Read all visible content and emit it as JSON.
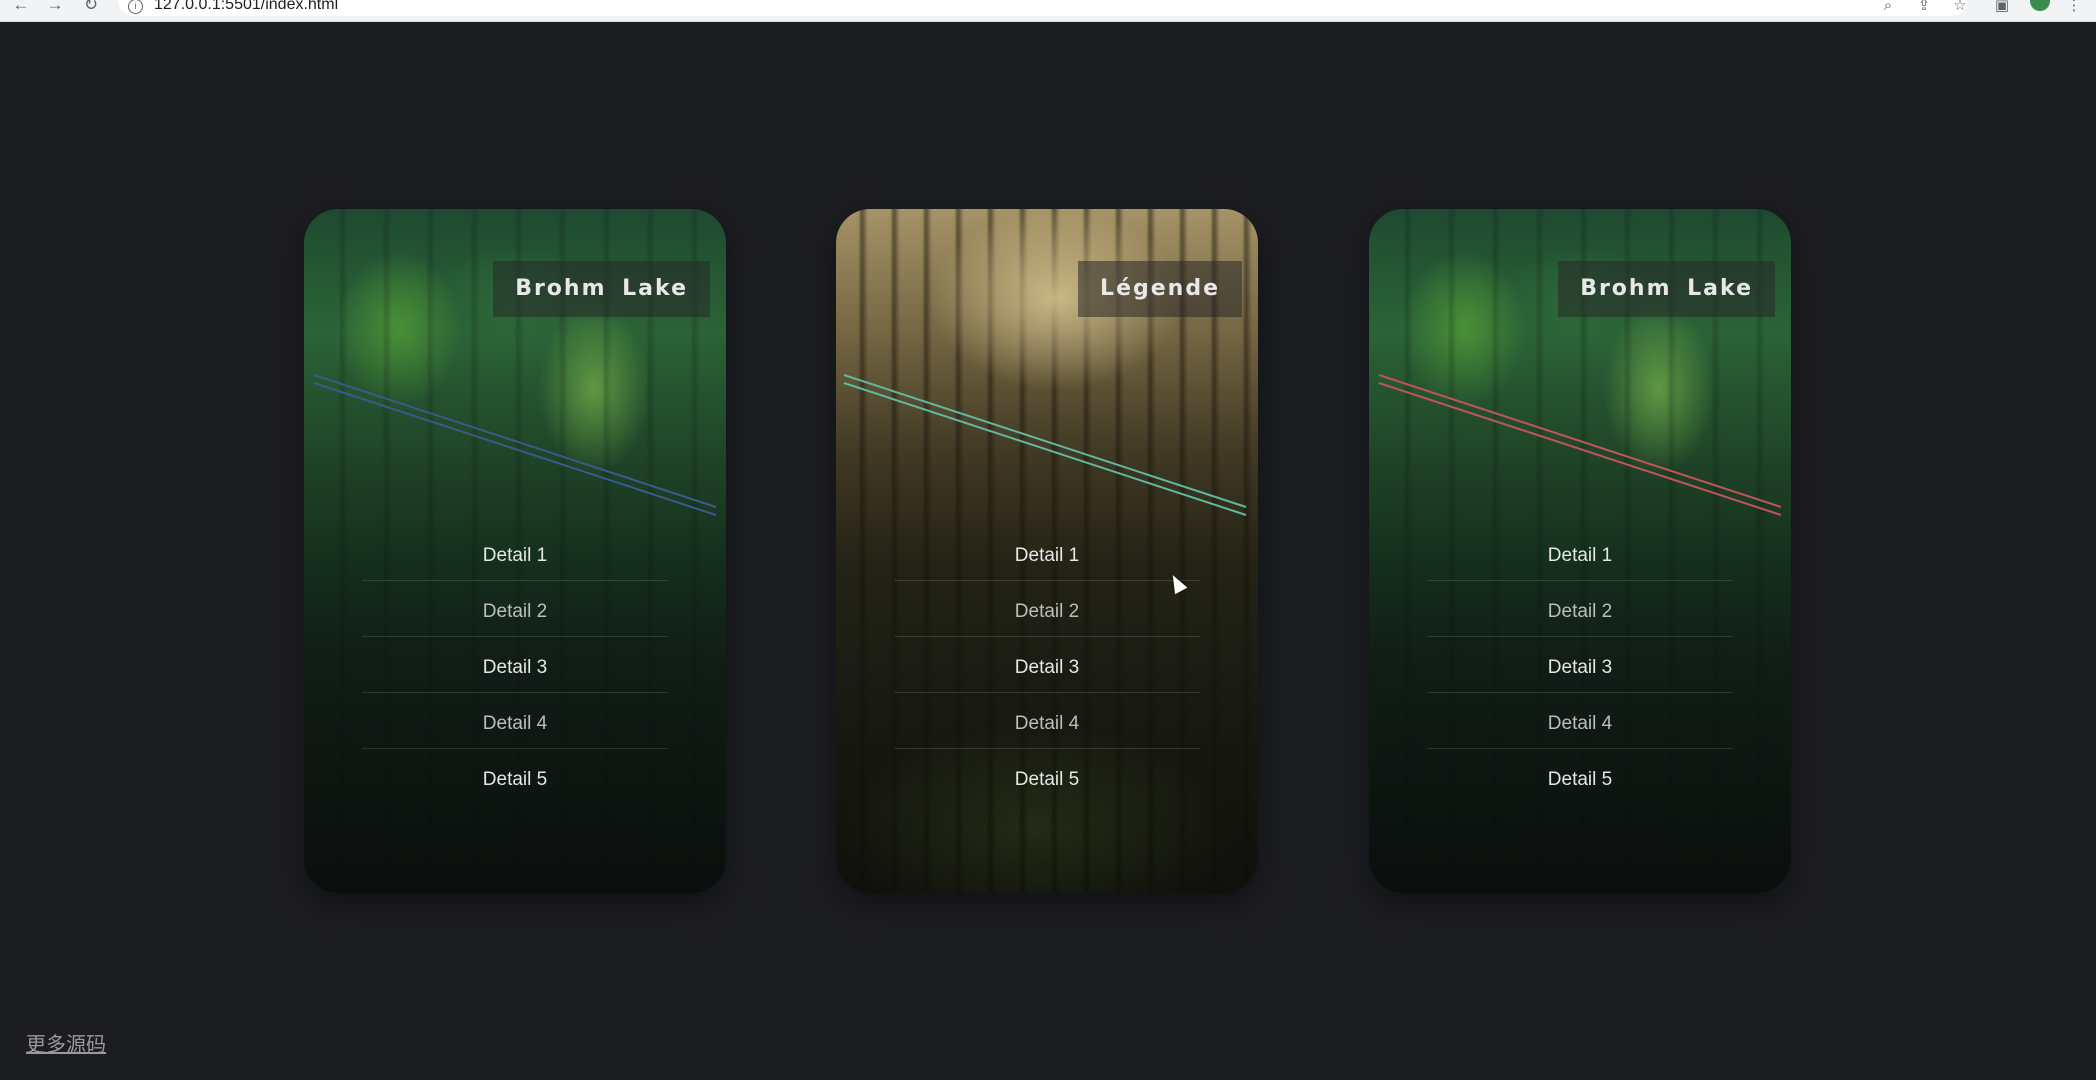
{
  "browser": {
    "url": "127.0.0.1:5501/index.html",
    "icons": [
      "back-icon",
      "forward-icon",
      "reload-icon",
      "info-icon",
      "zoom-icon",
      "share-icon",
      "star-icon",
      "sidebar-icon",
      "profile-icon",
      "menu-icon"
    ]
  },
  "cards": [
    {
      "caption": "Brohm Lake",
      "accent": "#3a5a8a",
      "details": [
        "Detail 1",
        "Detail 2",
        "Detail 3",
        "Detail 4",
        "Detail 5"
      ]
    },
    {
      "caption": "Légende",
      "accent": "#5fb8a0",
      "details": [
        "Detail 1",
        "Detail 2",
        "Detail 3",
        "Detail 4",
        "Detail 5"
      ]
    },
    {
      "caption": "Brohm Lake",
      "accent": "#c0545a",
      "details": [
        "Detail 1",
        "Detail 2",
        "Detail 3",
        "Detail 4",
        "Detail 5"
      ]
    }
  ],
  "footer": {
    "link_label": "更多源码"
  }
}
